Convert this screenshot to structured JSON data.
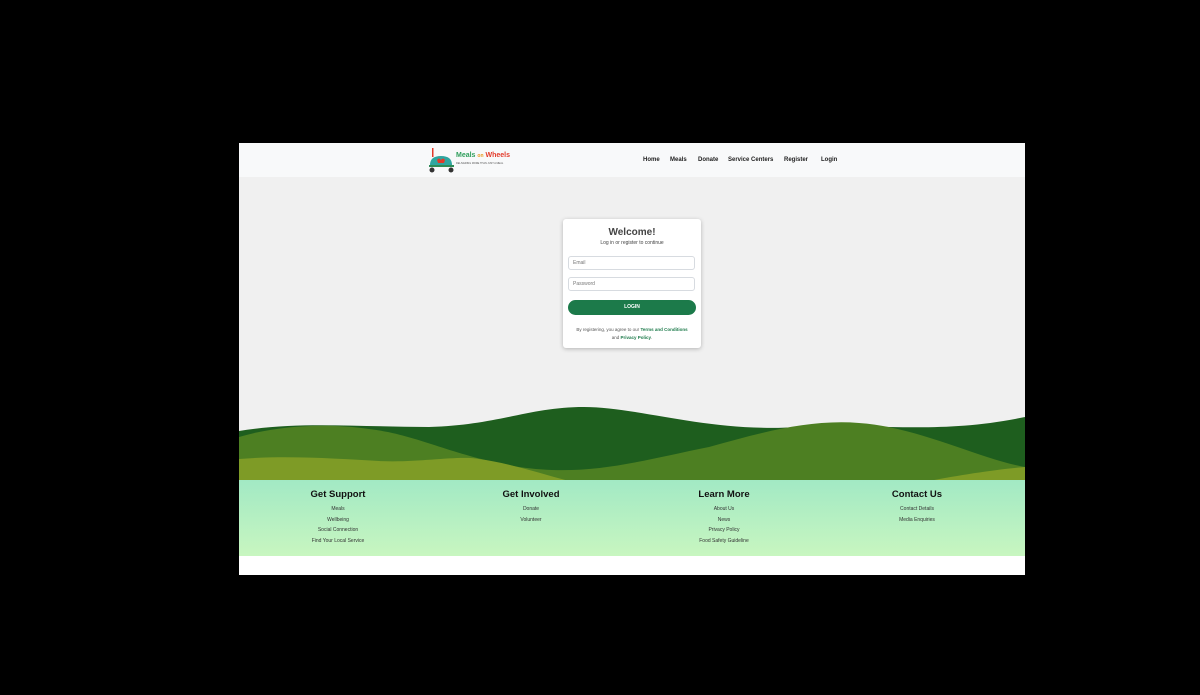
{
  "brand": {
    "name_part1": "Meals",
    "name_part2": "on",
    "name_part3": "Wheels",
    "tagline": "DELIVERING MORE THAN JUST A MEAL",
    "colors": {
      "green": "#2e9e5b",
      "orange": "#e89a1f",
      "red": "#e23a2a"
    }
  },
  "nav": {
    "items": [
      "Home",
      "Meals",
      "Donate",
      "Service Centers",
      "Register",
      "Login"
    ]
  },
  "login": {
    "title": "Welcome!",
    "subtitle": "Log in or register to continue",
    "email_placeholder": "Email",
    "password_placeholder": "Password",
    "button_label": "LOGIN",
    "terms_prefix": "By registering, you agree to our",
    "terms_link": "Terms and Conditions",
    "terms_and": "and",
    "privacy_link": "Privacy Policy",
    "terms_suffix": "."
  },
  "footer": {
    "columns": [
      {
        "title": "Get Support",
        "links": [
          "Meals",
          "Wellbeing",
          "Social Connection",
          "Find Your Local Service"
        ]
      },
      {
        "title": "Get Involved",
        "links": [
          "Donate",
          "Volunteer"
        ]
      },
      {
        "title": "Learn More",
        "links": [
          "About Us",
          "News",
          "Privacy Policy",
          "Food Safety Guideline"
        ]
      },
      {
        "title": "Contact Us",
        "links": [
          "Contact Details",
          "Media Enquiries"
        ]
      }
    ]
  },
  "colors": {
    "primary_green": "#1c7a4a",
    "hill_dark": "#1e5e1e",
    "hill_mid": "#4d7f22",
    "hill_light": "#7e9b26",
    "footer_top": "#a2e9c4",
    "footer_bottom": "#c8f6c0"
  },
  "icons": {
    "logo": "delivery-cart-icon"
  }
}
